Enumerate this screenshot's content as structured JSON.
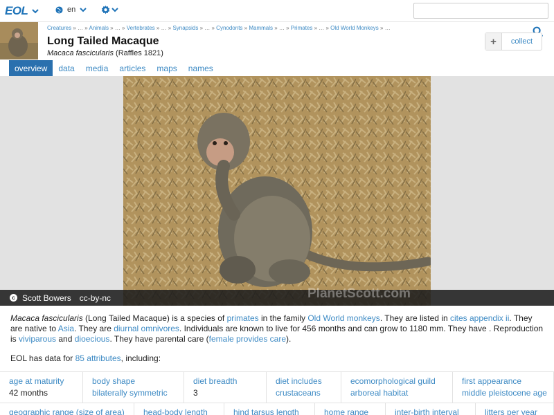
{
  "app": {
    "logo": "EOL"
  },
  "topbar": {
    "language": "en",
    "search_placeholder": ""
  },
  "breadcrumb": [
    {
      "label": "Creatures",
      "link": true
    },
    {
      "label": " » … » ",
      "link": false
    },
    {
      "label": "Animals",
      "link": true
    },
    {
      "label": " » … » ",
      "link": false
    },
    {
      "label": "Vertebrates",
      "link": true
    },
    {
      "label": " » … » ",
      "link": false
    },
    {
      "label": "Synapsids",
      "link": true
    },
    {
      "label": " » … » ",
      "link": false
    },
    {
      "label": "Cynodonts",
      "link": true
    },
    {
      "label": " » ",
      "link": false
    },
    {
      "label": "Mammals",
      "link": true
    },
    {
      "label": " » … » ",
      "link": false
    },
    {
      "label": "Primates",
      "link": true
    },
    {
      "label": " » … » ",
      "link": false
    },
    {
      "label": "Old World Monkeys",
      "link": true
    },
    {
      "label": " » …",
      "link": false
    }
  ],
  "page": {
    "title": "Long Tailed Macaque",
    "scientific_name": "Macaca fascicularis",
    "authority": " (Raffles 1821)",
    "collect_label": "collect"
  },
  "tabs": [
    {
      "label": "overview",
      "active": true
    },
    {
      "label": "data",
      "active": false
    },
    {
      "label": "media",
      "active": false
    },
    {
      "label": "articles",
      "active": false
    },
    {
      "label": "maps",
      "active": false
    },
    {
      "label": "names",
      "active": false
    }
  ],
  "media": {
    "author": "Scott Bowers",
    "license": "cc-by-nc",
    "watermark": "PlanetScott.com"
  },
  "description": [
    {
      "t": "Macaca fascicularis",
      "style": "italic"
    },
    {
      "t": " (Long Tailed Macaque) is a species of "
    },
    {
      "t": "primates",
      "style": "link"
    },
    {
      "t": " in the family "
    },
    {
      "t": "Old World monkeys",
      "style": "link"
    },
    {
      "t": ". They are listed in "
    },
    {
      "t": "cites appendix ii",
      "style": "link"
    },
    {
      "t": ". They are native to "
    },
    {
      "t": "Asia",
      "style": "link"
    },
    {
      "t": ". They are "
    },
    {
      "t": "diurnal omnivores",
      "style": "link"
    },
    {
      "t": ". Individuals are known to live for 456 months and can grow to 1180 mm. They have . Reproduction is "
    },
    {
      "t": "viviparous",
      "style": "link"
    },
    {
      "t": " and "
    },
    {
      "t": "dioecious",
      "style": "link"
    },
    {
      "t": ". They have parental care ("
    },
    {
      "t": "female provides care",
      "style": "link"
    },
    {
      "t": ")."
    }
  ],
  "eol_data": {
    "prefix": "EOL has data for ",
    "attributes_link": "85 attributes",
    "suffix": ", including:"
  },
  "traits_row1": [
    {
      "key": "age at maturity",
      "value": "42 months",
      "value_link": false
    },
    {
      "key": "body shape",
      "value": "bilaterally symmetric",
      "value_link": true
    },
    {
      "key": "diet breadth",
      "value": "3",
      "value_link": false
    },
    {
      "key": "diet includes",
      "value": "crustaceans",
      "value_link": true
    },
    {
      "key": "ecomorphological guild",
      "value": "arboreal habitat",
      "value_link": true
    },
    {
      "key": "first appearance",
      "value": "middle pleistocene age",
      "value_link": true
    }
  ],
  "traits_row2": [
    {
      "key": "geographic range (size of area)"
    },
    {
      "key": "head-body length"
    },
    {
      "key": "hind tarsus length"
    },
    {
      "key": "home range"
    },
    {
      "key": "inter-birth interval"
    },
    {
      "key": "litters per year"
    }
  ]
}
